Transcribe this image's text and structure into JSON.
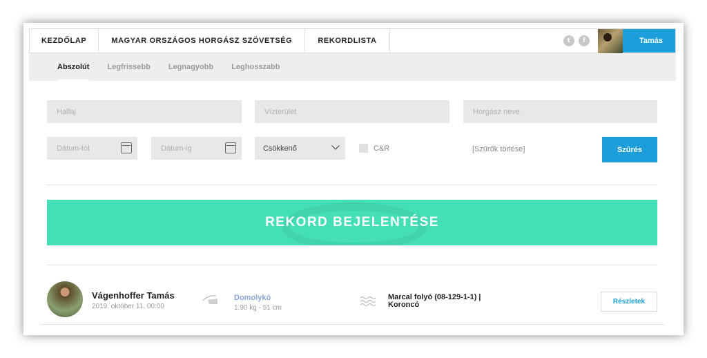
{
  "nav": {
    "items": [
      "KEZDŐLAP",
      "MAGYAR ORSZÁGOS HORGÁSZ SZÖVETSÉG",
      "REKORDLISTA"
    ],
    "social": [
      "twitter-icon",
      "facebook-icon"
    ],
    "user": "Tamás"
  },
  "tabs": [
    "Abszolút",
    "Legfrissebb",
    "Legnagyobb",
    "Leghosszabb"
  ],
  "filters": {
    "species_placeholder": "Halfaj",
    "water_placeholder": "Vízterület",
    "angler_placeholder": "Horgász neve",
    "date_from_placeholder": "Dátum-tól",
    "date_to_placeholder": "Dátum-ig",
    "order_value": "Csökkenő",
    "cr_label": "C&R",
    "clear_label": "[Szűrők törlése]",
    "submit_label": "Szűrés"
  },
  "banner": {
    "label": "REKORD BEJELENTÉSE"
  },
  "record": {
    "name": "Vágenhoffer Tamás",
    "date": "2019. október 11. 00:00",
    "species": "Domolykó",
    "weight": "1.90 kg - 51 cm",
    "water": "Marcal folyó (08-129-1-1) | Koroncó",
    "details_label": "Részletek"
  },
  "colors": {
    "accent": "#1b9ed9",
    "banner": "#45dfb6",
    "species": "#8aa6d9"
  }
}
